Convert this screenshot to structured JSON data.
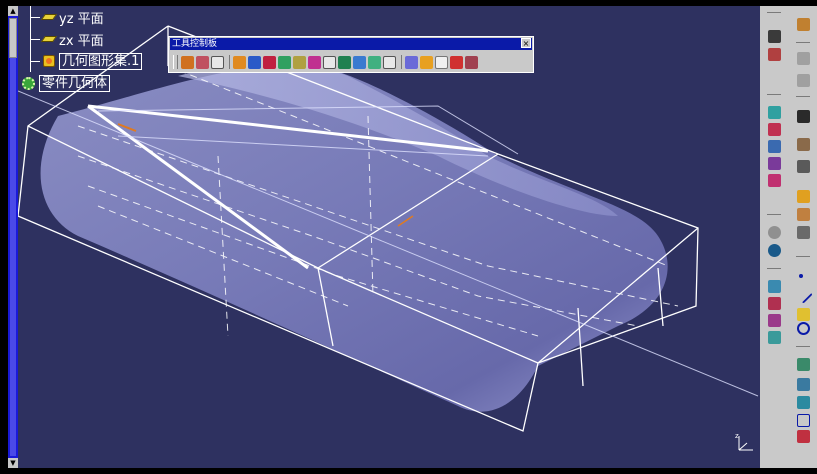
{
  "tree": {
    "items": [
      {
        "label": "yz 平面",
        "icon": "plane-icon"
      },
      {
        "label": "zx 平面",
        "icon": "plane-icon"
      },
      {
        "label": "几何图形集.1",
        "icon": "geometrical-set-icon"
      },
      {
        "label": "零件几何体",
        "icon": "part-body-icon"
      }
    ]
  },
  "toolbar": {
    "title": "工具控制板",
    "close_symbol": "×"
  },
  "colors": {
    "viewport_background": "#2e3160",
    "toolbar_title_bar": "#0a1aa8",
    "panel_gray": "#c9c9c9",
    "tree_text": "#ffffff",
    "scrollbar": "#1a1ad8"
  },
  "compass": {
    "label": "z"
  }
}
